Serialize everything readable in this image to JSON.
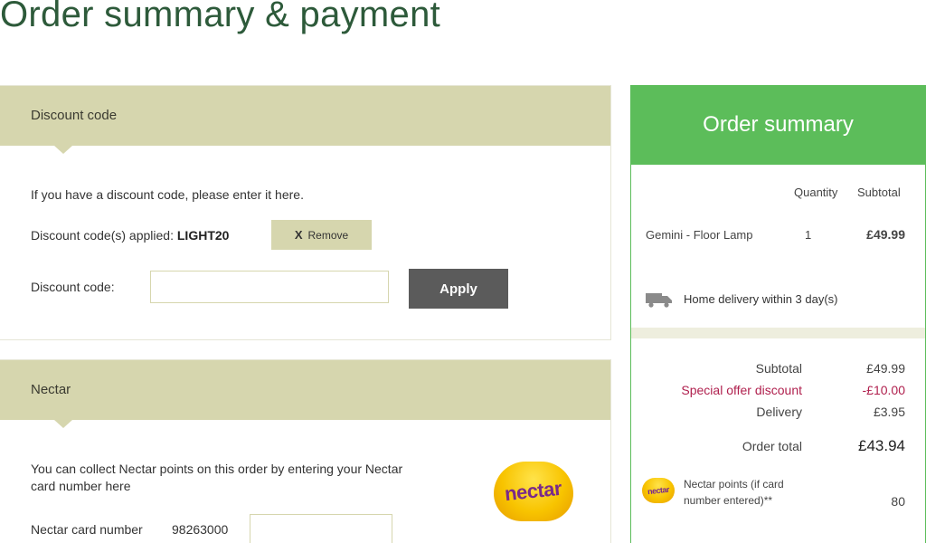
{
  "page": {
    "title": "Order summary & payment"
  },
  "discount": {
    "header": "Discount code",
    "intro": "If you have a discount code, please enter it here.",
    "applied_label": "Discount code(s) applied:",
    "applied_code": "LIGHT20",
    "remove_x": "X",
    "remove_label": "Remove",
    "field_label": "Discount code:",
    "input_value": "",
    "apply_label": "Apply"
  },
  "nectar": {
    "header": "Nectar",
    "intro_line1": "You can collect Nectar points on this order by entering your Nectar",
    "intro_line2": "card number here",
    "card_label": "Nectar card number",
    "card_prefix": "98263000",
    "card_input_value": "",
    "logo_text": "nectar"
  },
  "summary": {
    "header": "Order summary",
    "col_quantity": "Quantity",
    "col_subtotal": "Subtotal",
    "item_name": "Gemini - Floor Lamp",
    "item_qty": "1",
    "item_price": "£49.99",
    "delivery_note": "Home delivery within 3 day(s)",
    "subtotal_label": "Subtotal",
    "subtotal_value": "£49.99",
    "discount_label": "Special offer discount",
    "discount_value": "-£10.00",
    "delivery_label": "Delivery",
    "delivery_value": "£3.95",
    "total_label": "Order total",
    "total_value": "£43.94",
    "nectar_line1": "Nectar points (if card",
    "nectar_line2": "number entered)**",
    "nectar_points": "80",
    "nectar_logo_text": "nectar"
  },
  "colors": {
    "title_green": "#2d5a3a",
    "panel_beige": "#d6d6ae",
    "summary_green": "#5cbd5a",
    "apply_gray": "#5b5b5b",
    "discount_red": "#b0204e"
  }
}
